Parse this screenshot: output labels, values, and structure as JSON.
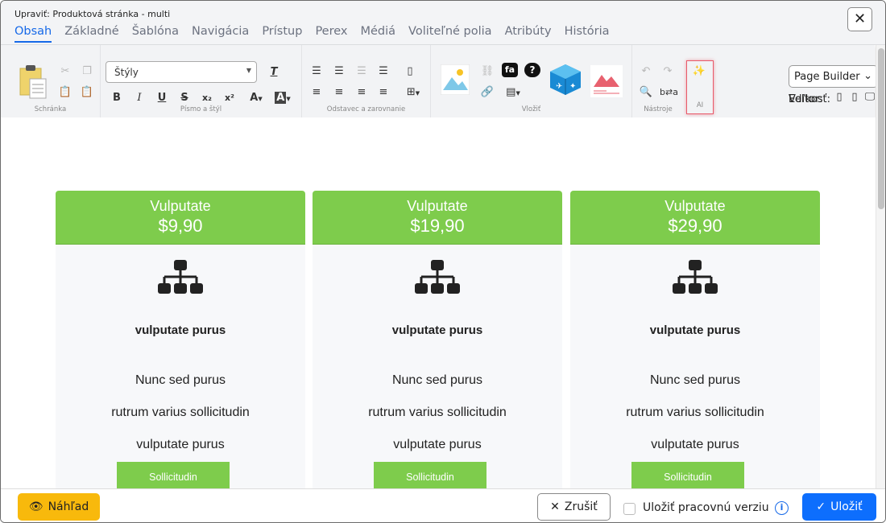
{
  "window": {
    "title": "Upraviť: Produktová stránka - multi",
    "close_icon": "close-icon"
  },
  "tabs": [
    {
      "label": "Obsah",
      "active": true
    },
    {
      "label": "Základné"
    },
    {
      "label": "Šablóna"
    },
    {
      "label": "Navigácia"
    },
    {
      "label": "Prístup"
    },
    {
      "label": "Perex"
    },
    {
      "label": "Médiá"
    },
    {
      "label": "Voliteľné polia"
    },
    {
      "label": "Atribúty"
    },
    {
      "label": "História"
    }
  ],
  "toolbar": {
    "groups": {
      "clipboard": "Schránka",
      "font": "Písmo a štýl",
      "paragraph": "Odstavec a zarovnanie",
      "insert": "Vložiť",
      "tools": "Nástroje",
      "ai": "AI"
    },
    "styles_select": "Štýly"
  },
  "editor_panel": {
    "editor_label": "Editor:",
    "editor_value": "Page Builder",
    "size_label": "Veľkosť:"
  },
  "cards": [
    {
      "name": "Vulputate",
      "price": "$9,90",
      "subtitle": "vulputate purus",
      "features": [
        "Nunc sed purus",
        "rutrum varius sollicitudin",
        "vulputate purus"
      ],
      "button": "Sollicitudin"
    },
    {
      "name": "Vulputate",
      "price": "$19,90",
      "subtitle": "vulputate purus",
      "features": [
        "Nunc sed purus",
        "rutrum varius sollicitudin",
        "vulputate purus"
      ],
      "button": "Sollicitudin"
    },
    {
      "name": "Vulputate",
      "price": "$29,90",
      "subtitle": "vulputate purus",
      "features": [
        "Nunc sed purus",
        "rutrum varius sollicitudin",
        "vulputate purus"
      ],
      "button": "Sollicitudin"
    }
  ],
  "footer": {
    "preview": "Náhľad",
    "cancel": "Zrušiť",
    "save_draft": "Uložiť pracovnú verziu",
    "save": "Uložiť"
  },
  "colors": {
    "accent": "#1669e8",
    "card_green": "#7ecc4c",
    "preview_yellow": "#f8b90c"
  }
}
